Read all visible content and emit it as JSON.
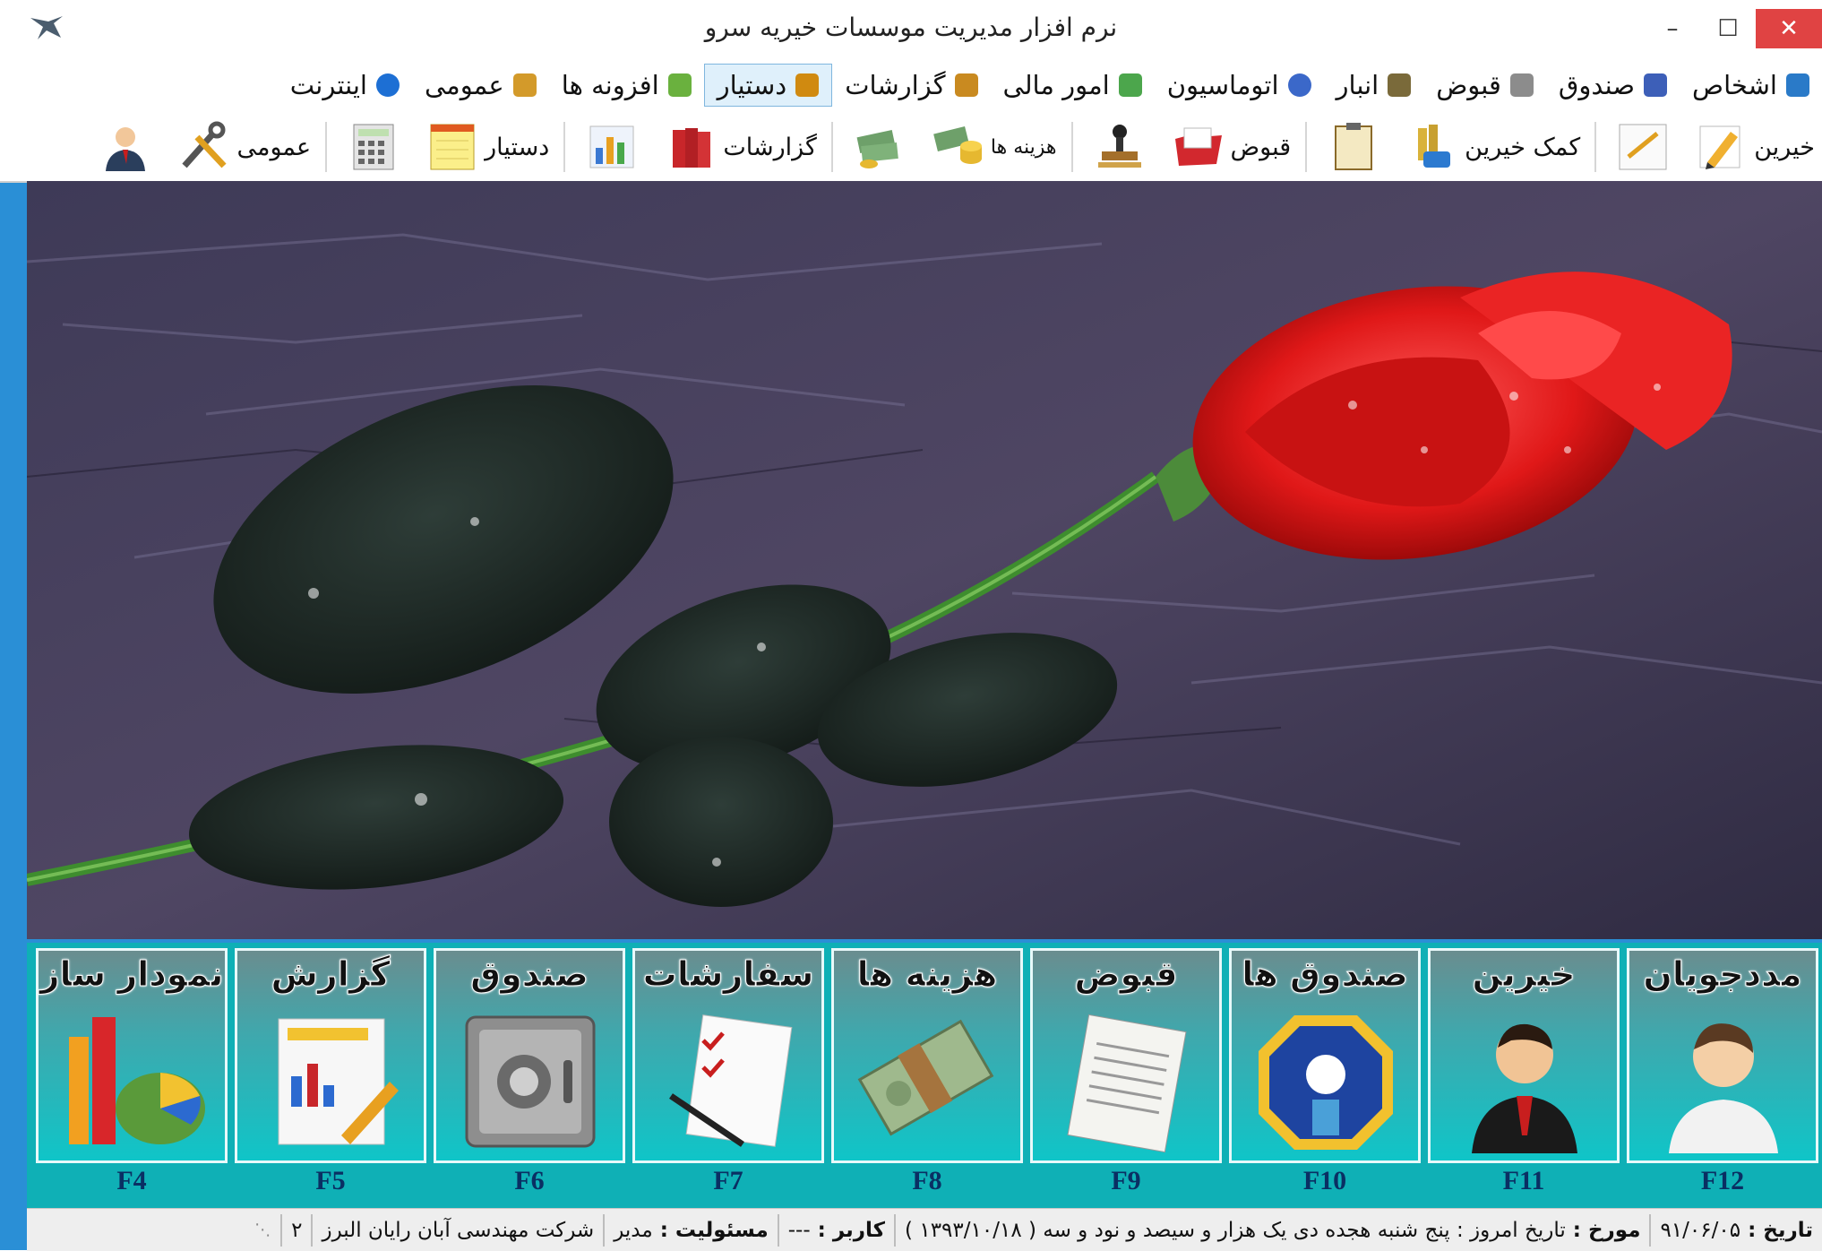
{
  "window": {
    "title": "نرم افزار مدیریت موسسات خیریه سرو",
    "controls": {
      "minimize": "–",
      "maximize": "☐",
      "close": "✕"
    }
  },
  "menu": [
    {
      "label": "اشخاص",
      "icon": "people-icon",
      "color": "#2a7ac8"
    },
    {
      "label": "صندوق",
      "icon": "charity-box-icon",
      "color": "#3d5fb8"
    },
    {
      "label": "قبوض",
      "icon": "receipt-icon",
      "color": "#6b6b6b"
    },
    {
      "label": "انبار",
      "icon": "warehouse-icon",
      "color": "#7a6a3a"
    },
    {
      "label": "اتوماسیون",
      "icon": "automation-icon",
      "color": "#3b68c9"
    },
    {
      "label": "امور مالی",
      "icon": "money-icon",
      "color": "#4ca64c"
    },
    {
      "label": "گزارشات",
      "icon": "reports-icon",
      "color": "#c98a20"
    },
    {
      "label": "دستیار",
      "icon": "assistant-icon",
      "color": "#d08a10",
      "active": true
    },
    {
      "label": "افزونه ها",
      "icon": "addons-icon",
      "color": "#6ab13e"
    },
    {
      "label": "عمومی",
      "icon": "general-icon",
      "color": "#d39a2a"
    },
    {
      "label": "اینترنت",
      "icon": "internet-explorer-icon",
      "color": "#1d6fd4"
    }
  ],
  "toolbar": [
    {
      "label": "خیرین",
      "icon": "pencil-icon"
    },
    {
      "label": "",
      "icon": "ruler-icon"
    },
    {
      "sep": true
    },
    {
      "label": "کمک خیرین",
      "icon": "donation-icon"
    },
    {
      "label": "",
      "icon": "clipboard-icon"
    },
    {
      "sep": true
    },
    {
      "label": "قبوض",
      "icon": "open-folder-icon"
    },
    {
      "label": "",
      "icon": "stamp-icon"
    },
    {
      "sep": true
    },
    {
      "label": "هزینه ها",
      "icon": "coins-icon"
    },
    {
      "label": "",
      "icon": "cash-icon"
    },
    {
      "sep": true
    },
    {
      "label": "گزارشات",
      "icon": "binders-icon"
    },
    {
      "label": "",
      "icon": "bar-chart-icon"
    },
    {
      "sep": true
    },
    {
      "label": "دستیار",
      "icon": "notepad-icon"
    },
    {
      "label": "",
      "icon": "calculator-icon"
    },
    {
      "sep": true
    },
    {
      "label": "عمومی",
      "icon": "tools-icon"
    },
    {
      "label": "",
      "icon": "user-icon"
    }
  ],
  "tiles": [
    {
      "label": "مددجویان",
      "key": "F12",
      "icon": "client-icon"
    },
    {
      "label": "خیرین",
      "key": "F11",
      "icon": "donor-icon"
    },
    {
      "label": "صندوق ها",
      "key": "F10",
      "icon": "charity-box-icon"
    },
    {
      "label": "قبوض",
      "key": "F9",
      "icon": "scroll-icon"
    },
    {
      "label": "هزینه ها",
      "key": "F8",
      "icon": "banknotes-icon"
    },
    {
      "label": "سفارشات",
      "key": "F7",
      "icon": "checklist-icon"
    },
    {
      "label": "صندوق",
      "key": "F6",
      "icon": "safe-icon"
    },
    {
      "label": "گزارش",
      "key": "F5",
      "icon": "report-icon"
    },
    {
      "label": "نمودار ساز",
      "key": "F4",
      "icon": "chart-builder-icon"
    }
  ],
  "status": {
    "date_label": "تاریخ :",
    "date_value": "۹۱/۰۶/۰۵",
    "history_label": "مورخ :",
    "history_value": "تاریخ امروز : پنج شنبه هجده  دی یک هزار و سیصد و نود و سه ( ۱۳۹۳/۱۰/۱۸ )",
    "user_label": "کاربر :",
    "user_value": "---",
    "role_label": "مسئولیت :",
    "role_value": "مدیر",
    "company": "شرکت مهندسی آبان رایان البرز",
    "page": "۲"
  }
}
